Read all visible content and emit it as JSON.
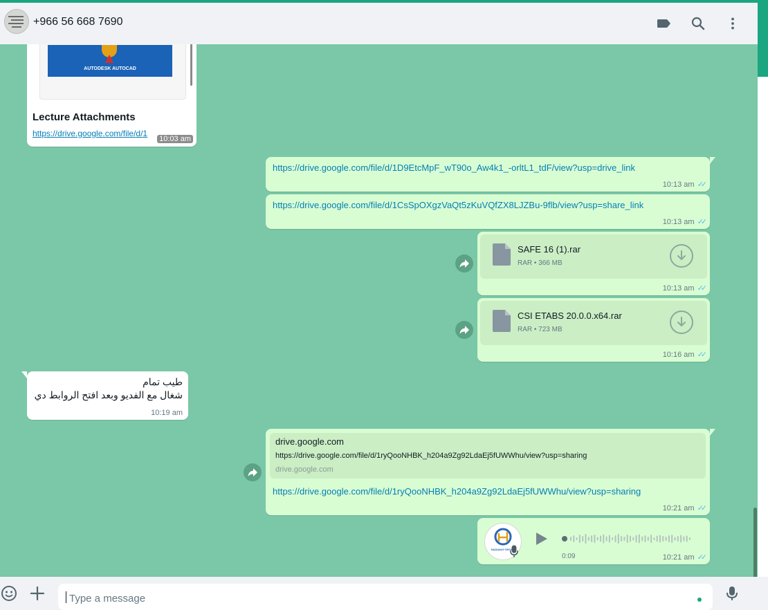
{
  "header": {
    "contact_name": "+966 56 668 7690",
    "icons": [
      "label-icon",
      "search-icon",
      "menu-icon"
    ]
  },
  "messages": {
    "m1": {
      "image_caption": "AUTODESK AUTOCAD",
      "title": "Lecture Attachments",
      "link": "https://drive.google.com/file/d/1",
      "time": "10:03 am"
    },
    "m2": {
      "link": "https://drive.google.com/file/d/1D9EtcMpF_wT90o_Aw4k1_-orltL1_tdF/view?usp=drive_link",
      "time": "10:13 am"
    },
    "m3": {
      "link": "https://drive.google.com/file/d/1CsSpOXgzVaQt5zKuVQfZX8LJZBu-9flb/view?usp=share_link",
      "time": "10:13 am"
    },
    "m4": {
      "file_name": "SAFE 16 (1).rar",
      "file_info": "RAR • 366 MB",
      "time": "10:13 am"
    },
    "m5": {
      "file_name": "CSI ETABS 20.0.0.x64.rar",
      "file_info": "RAR • 723 MB",
      "time": "10:16 am"
    },
    "m6": {
      "line1": "طيب تمام",
      "line2": "شغال مع الفديو وبعد افتح الروابط دي",
      "time": "10:19 am"
    },
    "m7": {
      "preview_title": "drive.google.com",
      "preview_url": "https://drive.google.com/file/d/1ryQooNHBK_h204a9Zg92LdaEj5fUWWhu/view?usp=sharing",
      "preview_domain": "drive.google.com",
      "link": "https://drive.google.com/file/d/1ryQooNHBK_h204a9Zg92LdaEj5fUWWhu/view?usp=sharing",
      "time": "10:21 am"
    },
    "m8": {
      "duration": "0:09",
      "time": "10:21 am",
      "avatar_text": "NADIANG GROUP"
    }
  },
  "input": {
    "placeholder": "Type a message"
  },
  "colors": {
    "accent": "#1aa680",
    "chat_bg": "#7ac8a7",
    "outgoing": "#d9fdd3",
    "link": "#027eb5",
    "read_ticks": "#53bdeb"
  }
}
